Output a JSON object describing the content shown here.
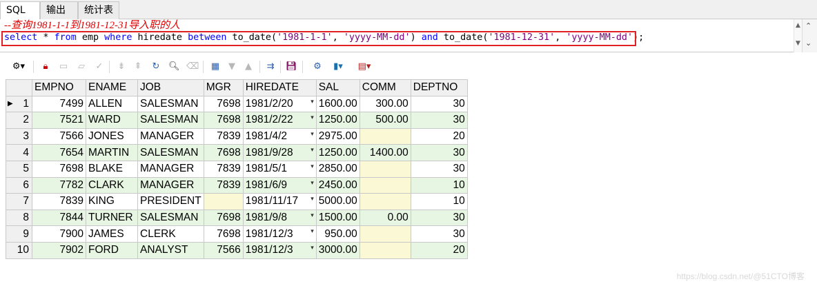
{
  "tabs": [
    "SQL",
    "输出",
    "统计表"
  ],
  "editor": {
    "comment": "--查询1981-1-1到1981-12-31导入职的人",
    "sql_tokens": [
      {
        "t": "select",
        "c": "kw"
      },
      {
        "t": " * ",
        "c": ""
      },
      {
        "t": "from",
        "c": "kw"
      },
      {
        "t": " emp ",
        "c": ""
      },
      {
        "t": "where",
        "c": "kw"
      },
      {
        "t": " hiredate ",
        "c": ""
      },
      {
        "t": "between",
        "c": "kw"
      },
      {
        "t": " to_date(",
        "c": ""
      },
      {
        "t": "'1981-1-1'",
        "c": "str"
      },
      {
        "t": ", ",
        "c": ""
      },
      {
        "t": "'yyyy-MM-dd'",
        "c": "str"
      },
      {
        "t": ") ",
        "c": ""
      },
      {
        "t": "and",
        "c": "kw"
      },
      {
        "t": " to_date(",
        "c": ""
      },
      {
        "t": "'1981-12-31'",
        "c": "str"
      },
      {
        "t": ", ",
        "c": ""
      },
      {
        "t": "'yyyy-MM-dd'",
        "c": "str"
      },
      {
        "t": ");",
        "c": ""
      }
    ]
  },
  "toolbar": {
    "icons": [
      "grid-options-icon",
      "lock-icon",
      "insert-record-icon",
      "delete-record-icon",
      "post-changes-icon",
      "first-record-icon",
      "last-record-icon",
      "refresh-icon",
      "find-icon",
      "clear-icon",
      "query-by-example-icon",
      "next-page-icon",
      "prev-page-icon",
      "connect-icon",
      "save-icon",
      "export-icon",
      "chart-icon",
      "table-view-icon"
    ]
  },
  "grid": {
    "columns": [
      "EMPNO",
      "ENAME",
      "JOB",
      "MGR",
      "HIREDATE",
      "SAL",
      "COMM",
      "DEPTNO"
    ],
    "rows": [
      {
        "n": "1",
        "cells": [
          "7499",
          "ALLEN",
          "SALESMAN",
          "7698",
          "1981/2/20",
          "1600.00",
          "300.00",
          "30"
        ]
      },
      {
        "n": "2",
        "cells": [
          "7521",
          "WARD",
          "SALESMAN",
          "7698",
          "1981/2/22",
          "1250.00",
          "500.00",
          "30"
        ]
      },
      {
        "n": "3",
        "cells": [
          "7566",
          "JONES",
          "MANAGER",
          "7839",
          "1981/4/2",
          "2975.00",
          "",
          "20"
        ]
      },
      {
        "n": "4",
        "cells": [
          "7654",
          "MARTIN",
          "SALESMAN",
          "7698",
          "1981/9/28",
          "1250.00",
          "1400.00",
          "30"
        ]
      },
      {
        "n": "5",
        "cells": [
          "7698",
          "BLAKE",
          "MANAGER",
          "7839",
          "1981/5/1",
          "2850.00",
          "",
          "30"
        ]
      },
      {
        "n": "6",
        "cells": [
          "7782",
          "CLARK",
          "MANAGER",
          "7839",
          "1981/6/9",
          "2450.00",
          "",
          "10"
        ]
      },
      {
        "n": "7",
        "cells": [
          "7839",
          "KING",
          "PRESIDENT",
          "",
          "1981/11/17",
          "5000.00",
          "",
          "10"
        ]
      },
      {
        "n": "8",
        "cells": [
          "7844",
          "TURNER",
          "SALESMAN",
          "7698",
          "1981/9/8",
          "1500.00",
          "0.00",
          "30"
        ]
      },
      {
        "n": "9",
        "cells": [
          "7900",
          "JAMES",
          "CLERK",
          "7698",
          "1981/12/3",
          "950.00",
          "",
          "30"
        ]
      },
      {
        "n": "10",
        "cells": [
          "7902",
          "FORD",
          "ANALYST",
          "7566",
          "1981/12/3",
          "3000.00",
          "",
          "20"
        ]
      }
    ]
  },
  "watermark": "https://blog.csdn.net/@51CTO博客"
}
